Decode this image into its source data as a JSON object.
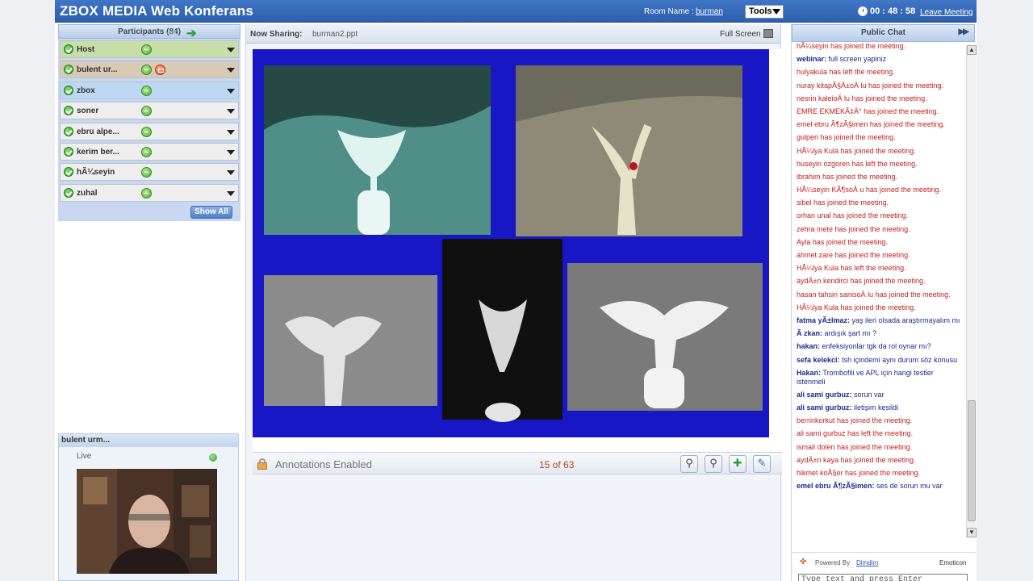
{
  "header": {
    "title": "ZBOX MEDIA Web Konferans",
    "room_label": "Room Name :",
    "room_name": "burman",
    "tools_label": "Tools",
    "timer": "00 : 48 : 58",
    "leave_label": "Leave Meeting"
  },
  "participants": {
    "header": "Participants (84)",
    "items": [
      {
        "name": "Host",
        "color": "#c8dea8",
        "hand": false
      },
      {
        "name": "bulent ur...",
        "color": "#d9cab5",
        "hand": true
      },
      {
        "name": "zbox",
        "color": "#bcd8f3",
        "hand": false
      },
      {
        "name": "soner",
        "color": "#eeeeee",
        "hand": false
      },
      {
        "name": "ebru alpe...",
        "color": "#eeeeee",
        "hand": false
      },
      {
        "name": "kerim ber...",
        "color": "#eeeeee",
        "hand": false
      },
      {
        "name": "hÃ¼seyin",
        "color": "#eeeeee",
        "hand": false
      },
      {
        "name": "zuhal",
        "color": "#eeeeee",
        "hand": false
      }
    ],
    "show_all_label": "Show All"
  },
  "video": {
    "title": "bulent urm...",
    "live_label": "Live"
  },
  "sharing": {
    "label": "Now Sharing:",
    "file": "burman2.ppt",
    "fullscreen_label": "Full Screen"
  },
  "annotations": {
    "label": "Annotations Enabled",
    "page": "15 of 63"
  },
  "chat": {
    "header": "Public Chat",
    "messages": [
      {
        "who": "",
        "text": "hÃ¼seyin has joined the meeting."
      },
      {
        "who": "webinar:",
        "text": "full screen yapiniz"
      },
      {
        "who": "",
        "text": "hulyakula has left the meeting."
      },
      {
        "who": "",
        "text": "nuray kitapÃ§Ä±oÄ   lu has joined the meeting."
      },
      {
        "who": "",
        "text": "nesrin kaleioÄ   lu has joined the meeting."
      },
      {
        "who": "",
        "text": "EMRE EKMEKÃ‡Ä° has joined the meeting."
      },
      {
        "who": "",
        "text": "emel ebru Ã¶zÃ§imen has joined the meeting."
      },
      {
        "who": "",
        "text": "gulperi has joined the meeting."
      },
      {
        "who": "",
        "text": "HÃ¼lya Kula has joined the meeting."
      },
      {
        "who": "",
        "text": "huseyin ozgoren has left the meeting."
      },
      {
        "who": "",
        "text": "ibrahim has joined the meeting."
      },
      {
        "who": "",
        "text": "HÃ¼seyin KÃ¶soÄ   u has joined the meeting."
      },
      {
        "who": "",
        "text": "sibel has joined the meeting."
      },
      {
        "who": "",
        "text": "orhan unal has joined the meeting."
      },
      {
        "who": "",
        "text": "zehra mete has joined the meeting."
      },
      {
        "who": "",
        "text": "Ayla has joined the meeting."
      },
      {
        "who": "",
        "text": "ahmet zare has joined the meeting."
      },
      {
        "who": "",
        "text": "HÃ¼lya Kula has left the meeting."
      },
      {
        "who": "",
        "text": "aydÄ±n kendirci has joined the meeting."
      },
      {
        "who": "",
        "text": "hasan tahsin sanisoÄ   lu has joined the meeting."
      },
      {
        "who": "",
        "text": "HÃ¼lya Kula has joined the meeting."
      },
      {
        "who": "fatma yÃ±lmaz:",
        "text": "yaş ileri olsada araştırmayalım mı"
      },
      {
        "who": "Ã   zkan:",
        "text": "ardışık şart mı ?"
      },
      {
        "who": "hakan:",
        "text": "enfeksiyonlar tgk da rol oynar mı?"
      },
      {
        "who": "sefa kelekci:",
        "text": "tsh içindemi aynı durum söz konusu"
      },
      {
        "who": "Hakan:",
        "text": "Trombofili ve APL için hangi testler istenmeli"
      },
      {
        "who": "ali sami gurbuz:",
        "text": "sorun var"
      },
      {
        "who": "ali sami gurbuz:",
        "text": "iletişim kesildi"
      },
      {
        "who": "",
        "text": "berrinkorkut has joined the meeting."
      },
      {
        "who": "",
        "text": "ali sami gurbuz has left the meeting."
      },
      {
        "who": "",
        "text": "ismail dolen has joined the meeting."
      },
      {
        "who": "",
        "text": "aydÄ±n kaya has joined the meeting."
      },
      {
        "who": "",
        "text": "hikmet koÅ§er has joined the meeting."
      },
      {
        "who": "emel ebru Ã¶zÃ§imen:",
        "text": "ses de sorun mu var"
      }
    ],
    "powered_label": "Powered By",
    "powered_link": "Dimdim",
    "emoticon_label": "Emoticon",
    "input_placeholder": "Type text and press Enter"
  },
  "colors": {
    "header_blue": "#2d5fae",
    "slide_blue": "#1717c6",
    "system_message": "#c21e1e",
    "user_name": "#1c2a8c"
  },
  "icons": [
    "clock-icon",
    "arrow-left-icon",
    "arrow-right-icon",
    "status-ok-icon",
    "chat-icon",
    "hand-raise-icon",
    "fullscreen-icon",
    "lock-icon",
    "zoom-out-icon",
    "zoom-in-icon",
    "pan-icon",
    "pen-icon",
    "expand-icon"
  ]
}
